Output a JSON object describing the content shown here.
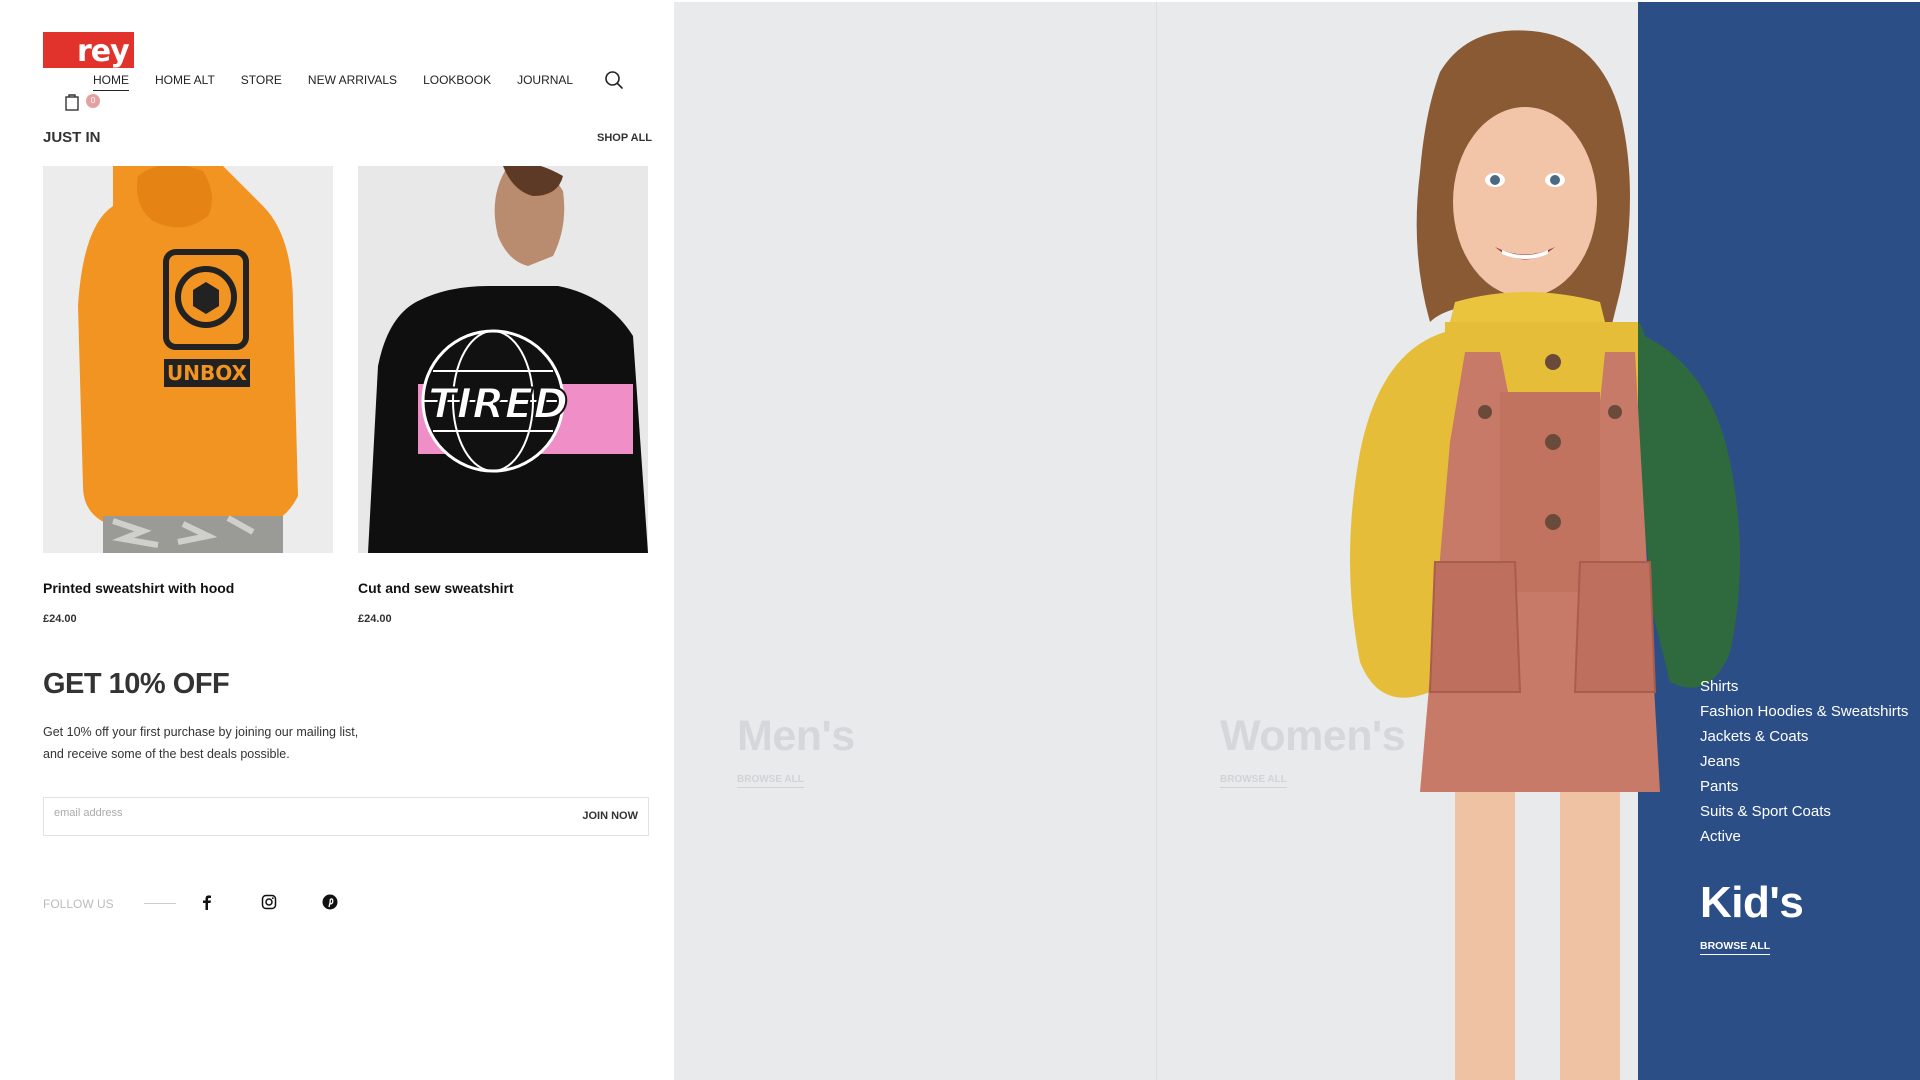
{
  "brand": {
    "logo_text": "rey",
    "accent_color": "#e1322b"
  },
  "nav": {
    "items": [
      "HOME",
      "HOME ALT",
      "STORE",
      "NEW ARRIVALS",
      "LOOKBOOK",
      "JOURNAL"
    ],
    "active": "HOME"
  },
  "cart": {
    "count": "0"
  },
  "just_in": {
    "title": "JUST IN",
    "shop_all": "SHOP ALL",
    "products": [
      {
        "name": "Printed sweatshirt with hood",
        "price": "£24.00",
        "print_text": "UNBOX"
      },
      {
        "name": "Cut and sew sweatshirt",
        "price": "£24.00",
        "print_text": "TIRED"
      }
    ]
  },
  "newsletter": {
    "title": "GET 10% OFF",
    "text_line1": "Get 10% off your first purchase by joining our mailing list,",
    "text_line2": "and receive some of the best deals possible.",
    "placeholder": "email address",
    "button": "JOIN NOW"
  },
  "follow": {
    "label": "FOLLOW US",
    "icons": [
      "facebook-icon",
      "instagram-icon",
      "pinterest-icon"
    ]
  },
  "categories": {
    "men": {
      "title": "Men's",
      "browse": "BROWSE ALL"
    },
    "women": {
      "title": "Women's",
      "browse": "BROWSE ALL"
    },
    "kids": {
      "title": "Kid's",
      "browse": "BROWSE ALL",
      "items": [
        "Shirts",
        "Fashion Hoodies & Sweatshirts",
        "Jackets & Coats",
        "Jeans",
        "Pants",
        "Suits & Sport Coats",
        "Active"
      ],
      "panel_color": "#2b4e87"
    }
  }
}
